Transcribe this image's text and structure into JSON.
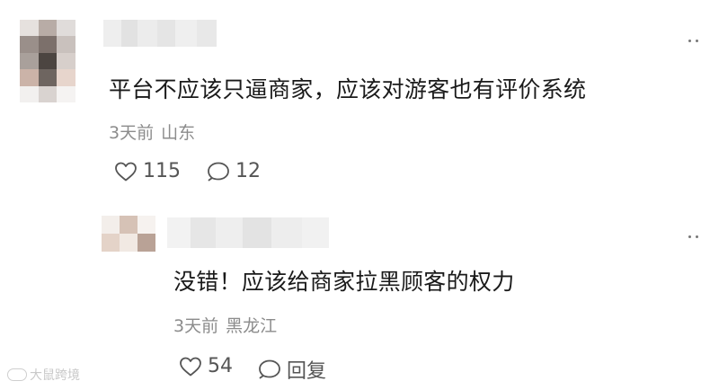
{
  "comments": [
    {
      "text": "平台不应该只逼商家，应该对游客也有评价系统",
      "time": "3天前",
      "location": "山东",
      "likes": "115",
      "replies": "12"
    },
    {
      "text": "没错！应该给商家拉黑顾客的权力",
      "time": "3天前",
      "location": "黑龙江",
      "likes": "54",
      "reply_label": "回复"
    }
  ],
  "watermark": "大鼠跨境",
  "icons": {
    "like": "heart-outline-icon",
    "comment": "speech-bubble-icon",
    "more": "more-dots-icon"
  }
}
